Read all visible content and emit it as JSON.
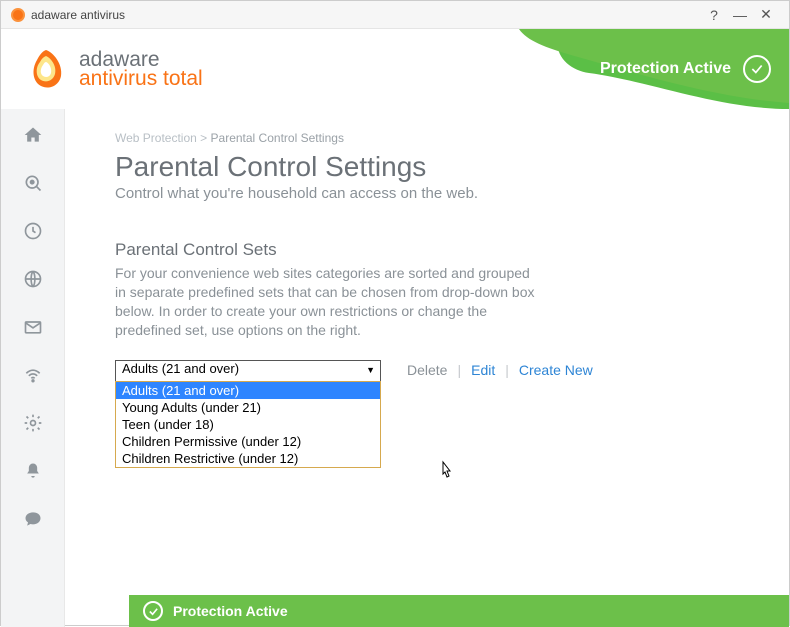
{
  "window": {
    "title": "adaware antivirus"
  },
  "branding": {
    "line1": "adaware",
    "line2": "antivirus total"
  },
  "header": {
    "status_text": "Protection Active"
  },
  "breadcrumb": {
    "parent": "Web Protection",
    "sep": ">",
    "current": "Parental Control Settings"
  },
  "page": {
    "title": "Parental Control Settings",
    "subtitle": "Control what you're household can access on the web."
  },
  "sets": {
    "title": "Parental Control Sets",
    "desc": "For your convenience web sites categories are sorted and grouped in separate predefined sets that can be chosen from drop-down box below. In order to create your own restrictions or change the predefined set, use options on the right."
  },
  "dropdown": {
    "selected": "Adults (21 and over)",
    "options": [
      "Adults (21 and over)",
      "Young Adults (under 21)",
      "Teen (under 18)",
      "Children Permissive (under 12)",
      "Children Restrictive (under 12)"
    ]
  },
  "actions": {
    "delete": "Delete",
    "edit": "Edit",
    "create": "Create New",
    "sep": "|"
  },
  "footer": {
    "status_text": "Protection Active"
  }
}
